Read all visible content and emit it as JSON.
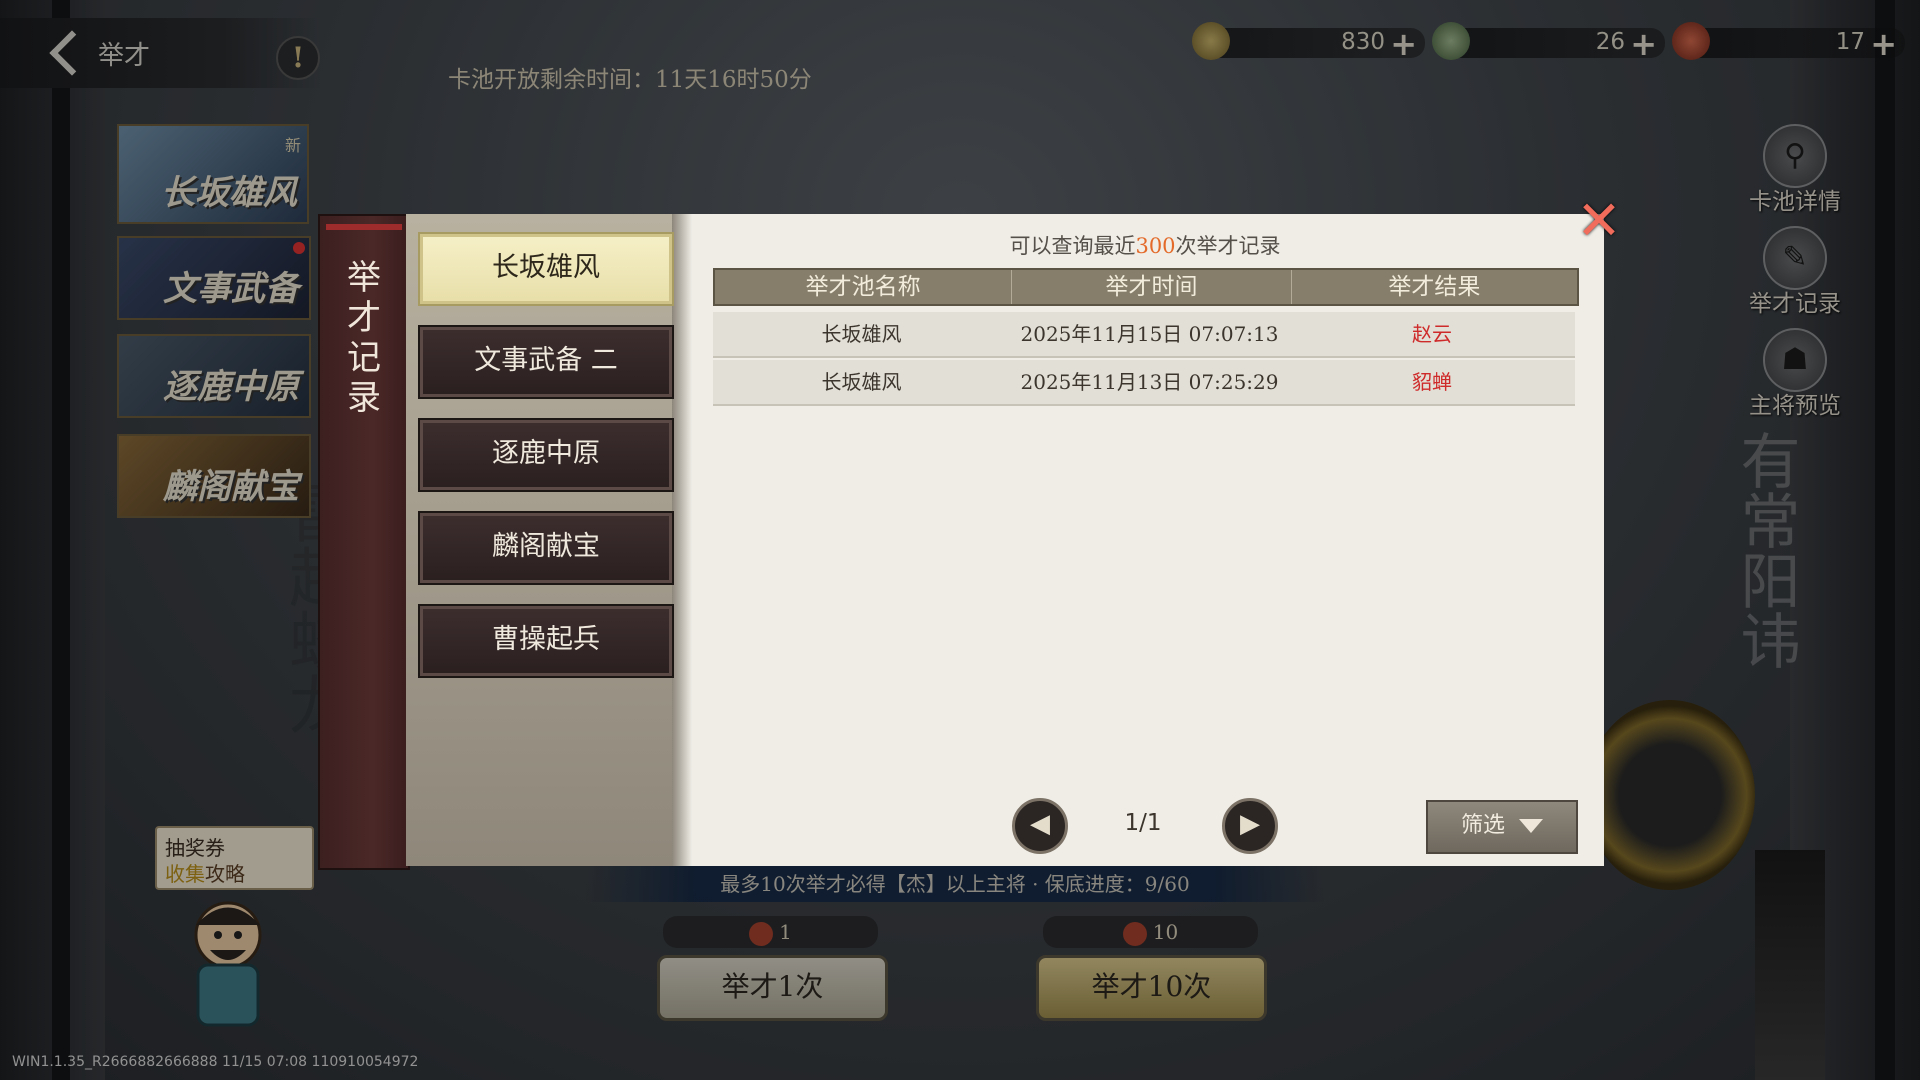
{
  "header": {
    "back_title": "举才",
    "help_label": "!",
    "timer_text": "卡池开放剩余时间：11天16时50分"
  },
  "resources": [
    {
      "name": "copper-coin",
      "value": "830",
      "color": "#8a7a44"
    },
    {
      "name": "jade",
      "value": "26",
      "color": "#5e7a55"
    },
    {
      "name": "seal",
      "value": "17",
      "color": "#9b3b2b"
    }
  ],
  "pools_banners": [
    {
      "text": "长坂雄风",
      "badge": "新"
    },
    {
      "text": "文事武备"
    },
    {
      "text": "逐鹿中原"
    },
    {
      "text": "麟阁献宝"
    }
  ],
  "lottery": {
    "line1": "抽奖券",
    "line2a": "收集",
    "line2b": "攻略"
  },
  "side_buttons": [
    {
      "label": "卡池详情",
      "icon": "magnifier-icon"
    },
    {
      "label": "举才记录",
      "icon": "brush-icon"
    },
    {
      "label": "主将预览",
      "icon": "helmet-icon"
    }
  ],
  "bottom": {
    "guarantee": "最多10次举才必得【杰】以上主将 · 保底进度：9/60",
    "cost_single": "1",
    "cost_ten": "10",
    "draw_single": "举才1次",
    "draw_ten": "举才10次"
  },
  "version": "WIN1.1.35_R2666882666888 11/15 07:08 110910054972",
  "modal": {
    "side_title": "举才记录",
    "pools": [
      "长坂雄风",
      "文事武备 二",
      "逐鹿中原",
      "麟阁献宝",
      "曹操起兵"
    ],
    "active_index": 0,
    "hint_prefix": "可以查询最近",
    "hint_count": "300",
    "hint_suffix": "次举才记录",
    "columns": [
      "举才池名称",
      "举才时间",
      "举才结果"
    ],
    "rows": [
      {
        "pool": "长坂雄风",
        "time": "2025年11月15日 07:07:13",
        "result": "赵云"
      },
      {
        "pool": "长坂雄风",
        "time": "2025年11月13日 07:25:29",
        "result": "貂蝉"
      }
    ],
    "pager": "1/1",
    "filter_label": "筛选",
    "close_label": "✕"
  },
  "bg_ink_left": "秋明主振雷起蛟龙",
  "bg_ink_right": "有常阳讳"
}
